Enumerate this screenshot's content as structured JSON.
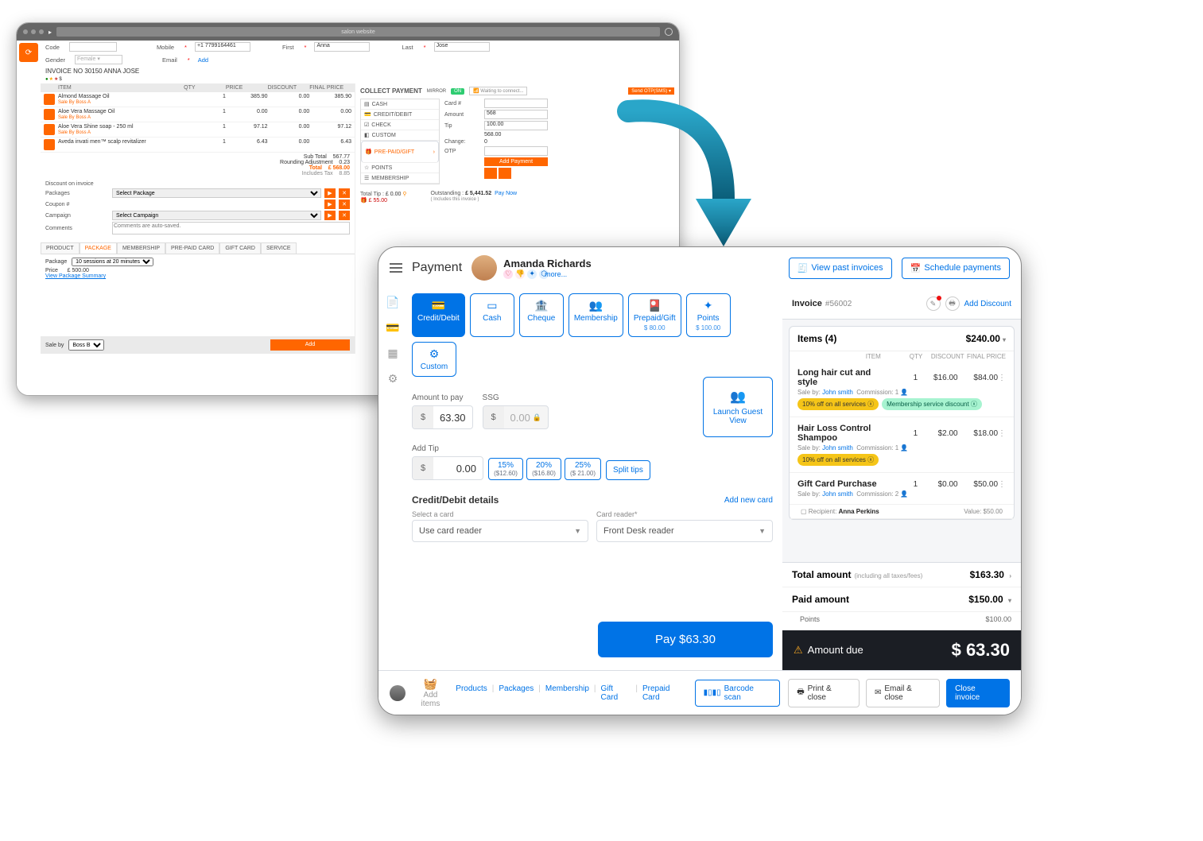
{
  "old": {
    "browser_title": "salon website",
    "fields": {
      "code": "Code",
      "mobile": "Mobile",
      "mobile_val": "+1 7799164461",
      "mobile_req": "*",
      "first": "First",
      "first_req": "*",
      "first_val": "Anna",
      "last": "Last",
      "last_req": "*",
      "last_val": "Jose",
      "gender": "Gender",
      "gender_val": "Female",
      "email": "Email",
      "email_req": "*",
      "email_link": "Add"
    },
    "invoice_label": "INVOICE NO 30150  ANNA JOSE",
    "invoice_legend": "$",
    "table_headers": {
      "item": "ITEM",
      "qty": "QTY",
      "price": "PRICE",
      "discount": "DISCOUNT",
      "final": "FINAL PRICE"
    },
    "items": [
      {
        "name": "Almond Massage Oil",
        "sale": "Sale By Boss A",
        "qty": "1",
        "price": "385.90",
        "discount": "0.00",
        "final": "385.90"
      },
      {
        "name": "Aloe Vera Massage Oil",
        "sale": "Sale By Boss A",
        "qty": "1",
        "price": "0.00",
        "discount": "0.00",
        "final": "0.00"
      },
      {
        "name": "Aloe Vera Shine soap - 250 ml",
        "sale": "Sale By Boss A",
        "qty": "1",
        "price": "97.12",
        "discount": "0.00",
        "final": "97.12"
      },
      {
        "name": "Aveda invati men™ scalp revitalizer",
        "sale": "",
        "qty": "1",
        "price": "6.43",
        "discount": "0.00",
        "final": "6.43"
      }
    ],
    "subtotal": {
      "sub_label": "Sub Total",
      "sub_val": "567.77",
      "round_label": "Rounding Adjustment",
      "round_val": "0.23",
      "total_label": "Total",
      "total_val": "£ 568.00",
      "tax_label": "Includes Tax",
      "tax_val": "8.85"
    },
    "discount": {
      "discount_label": "Discount on invoice",
      "packages": "Packages",
      "packages_sel": "Select Package",
      "coupon": "Coupon #",
      "campaign": "Campaign",
      "campaign_sel": "Select Campaign",
      "comments": "Comments",
      "comments_ph": "Comments are auto-saved."
    },
    "tabs": [
      "PRODUCT",
      "PACKAGE",
      "MEMBERSHIP",
      "PRE-PAID CARD",
      "GIFT CARD",
      "SERVICE"
    ],
    "pkg": {
      "package": "Package",
      "package_val": "10 sessions at 20 minutes",
      "price": "Price",
      "price_val": "£ 500.00",
      "link": "View Package Summary"
    },
    "saleby": {
      "label": "Sale by",
      "val": "Boss B",
      "btn": "Add"
    },
    "collect": {
      "title": "COLLECT PAYMENT",
      "mirror": "MIRROR",
      "on": "ON",
      "waiting": "Waiting to connect...",
      "otp": "Send OTP(SMS)",
      "methods": [
        "CASH",
        "CREDIT/DEBIT",
        "CHECK",
        "CUSTOM",
        "PRE-PAID/GIFT",
        "POINTS",
        "MEMBERSHIP"
      ],
      "form": {
        "card": "Card #",
        "amount": "Amount",
        "amount_val": "568",
        "tip": "Tip",
        "tip_val": "100.00",
        "blank_val": "568.00",
        "change": "Change:",
        "change_val": "0",
        "otp": "OTP"
      },
      "add": "Add Payment"
    },
    "totals": {
      "tip_label": "Total Tip :",
      "tip_val": "£ 0.00",
      "gift": "£ 55.00",
      "out_label": "Outstanding :",
      "out_val": "£ 5,441.52",
      "paynow": "Pay Now",
      "inc": "( Includes this invoice )"
    }
  },
  "new": {
    "title": "Payment",
    "guest": {
      "name": "Amanda Richards",
      "more": "more..."
    },
    "top_actions": {
      "past": "View past invoices",
      "schedule": "Schedule payments"
    },
    "methods": [
      {
        "key": "credit",
        "label": "Credit/Debit",
        "sub": ""
      },
      {
        "key": "cash",
        "label": "Cash",
        "sub": ""
      },
      {
        "key": "cheque",
        "label": "Cheque",
        "sub": ""
      },
      {
        "key": "membership",
        "label": "Membership",
        "sub": ""
      },
      {
        "key": "prepaid",
        "label": "Prepaid/Gift",
        "sub": "$ 80.00"
      },
      {
        "key": "points",
        "label": "Points",
        "sub": "$ 100.00"
      },
      {
        "key": "custom",
        "label": "Custom",
        "sub": ""
      }
    ],
    "amount_label": "Amount to pay",
    "amount_val": "63.30",
    "ssg_label": "SSG",
    "ssg_val": "0.00",
    "tip_label": "Add Tip",
    "tip_val": "0.00",
    "tip_pcts": [
      {
        "p": "15%",
        "v": "($12.60)"
      },
      {
        "p": "20%",
        "v": "($16.80)"
      },
      {
        "p": "25%",
        "v": "($ 21.00)"
      }
    ],
    "split": "Split tips",
    "guest_view": "Launch Guest View",
    "cc": {
      "title": "Credit/Debit details",
      "add": "Add new card",
      "select_label": "Select a card",
      "select_val": "Use card reader",
      "reader_label": "Card reader*",
      "reader_val": "Front Desk reader"
    },
    "pay_btn": "Pay $63.30",
    "invoice": {
      "label": "Invoice",
      "num": "#56002",
      "add_discount": "Add Discount",
      "items_count": "Items (4)",
      "items_total": "$240.00",
      "cols": {
        "item": "ITEM",
        "qty": "QTY",
        "discount": "DISCOUNT",
        "final": "FINAL PRICE"
      },
      "lines": [
        {
          "name": "Long hair cut and style",
          "qty": "1",
          "disc": "$16.00",
          "price": "$84.00",
          "sale": "John smith",
          "comm": "Commission: 1",
          "chips": [
            {
              "t": "10% off on all services",
              "c": "yellow",
              "x": "ⓧ"
            },
            {
              "t": "Membership service discount",
              "c": "green",
              "x": "ⓧ"
            }
          ]
        },
        {
          "name": "Hair Loss Control Shampoo",
          "qty": "1",
          "disc": "$2.00",
          "price": "$18.00",
          "sale": "John smith",
          "comm": "Commission: 1",
          "chips": [
            {
              "t": "10% off on all services",
              "c": "yellow",
              "x": "ⓧ"
            }
          ]
        },
        {
          "name": "Gift Card Purchase",
          "qty": "1",
          "disc": "$0.00",
          "price": "$50.00",
          "sale": "John smith",
          "comm": "Commission: 2",
          "recipient_label": "Recipient:",
          "recipient": "Anna Perkins",
          "value_label": "Value:",
          "value": "$50.00"
        }
      ],
      "total_label": "Total amount",
      "total_sub": "(including all taxes/fees)",
      "total_val": "$163.30",
      "paid_label": "Paid amount",
      "paid_val": "$150.00",
      "paid_sub": "Points",
      "paid_sub_val": "$100.00",
      "due_label": "Amount due",
      "due_val": "$ 63.30"
    },
    "bottom": {
      "add_items": "Add items",
      "links": [
        "Products",
        "Packages",
        "Membership",
        "Gift Card",
        "Prepaid Card"
      ],
      "barcode": "Barcode scan",
      "print": "Print & close",
      "email": "Email & close",
      "close": "Close invoice"
    }
  }
}
